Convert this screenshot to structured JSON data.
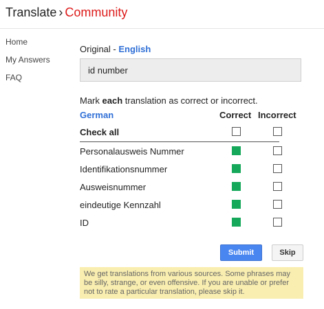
{
  "header": {
    "app_name": "Translate",
    "separator": "›",
    "section": "Community"
  },
  "sidebar": {
    "items": [
      {
        "label": "Home"
      },
      {
        "label": "My Answers"
      },
      {
        "label": "FAQ"
      }
    ]
  },
  "source": {
    "label": "Original -",
    "language": "English",
    "text": "id number"
  },
  "instruction": {
    "prefix": "Mark ",
    "emphasis": "each",
    "suffix": " translation as correct or incorrect."
  },
  "grid": {
    "target_language": "German",
    "col_correct": "Correct",
    "col_incorrect": "Incorrect",
    "check_all": "Check all",
    "rows": [
      {
        "text": "Personalausweis Nummer",
        "correct": true,
        "incorrect": false
      },
      {
        "text": "Identifikationsnummer",
        "correct": true,
        "incorrect": false
      },
      {
        "text": "Ausweisnummer",
        "correct": true,
        "incorrect": false
      },
      {
        "text": "eindeutige Kennzahl",
        "correct": true,
        "incorrect": false
      },
      {
        "text": "ID",
        "correct": true,
        "incorrect": false
      }
    ]
  },
  "buttons": {
    "submit": "Submit",
    "skip": "Skip"
  },
  "notice": "We get translations from various sources. Some phrases may be silly, strange, or even offensive. If you are unable or prefer not to rate a particular translation, please skip it.",
  "colors": {
    "accent_blue": "#2f6fd6",
    "brand_red": "#dd1a1a",
    "checked_green": "#16a85a",
    "notice_bg": "#f9eeb0"
  }
}
